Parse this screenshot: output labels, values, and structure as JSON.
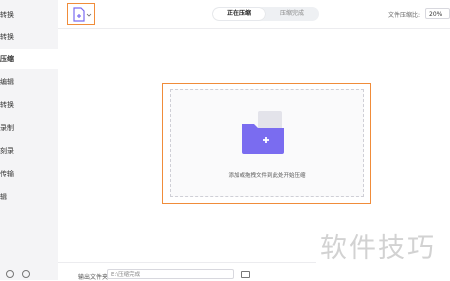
{
  "sidebar": {
    "items": [
      {
        "label": "转换"
      },
      {
        "label": "转换"
      },
      {
        "label": "压缩",
        "active": true
      },
      {
        "label": "编辑"
      },
      {
        "label": "转换"
      },
      {
        "label": "录制"
      },
      {
        "label": "刻录"
      },
      {
        "label": "传输"
      },
      {
        "label": "辑"
      }
    ],
    "bottom_icons": [
      "help-icon",
      "settings-icon"
    ]
  },
  "toolbar": {
    "add_file_icon": "add-file-icon",
    "dropdown_icon": "chevron-down-icon"
  },
  "tabs": [
    {
      "label": "正在压缩",
      "active": true
    },
    {
      "label": "压缩完成",
      "active": false
    }
  ],
  "compression": {
    "ratio_label": "文件压缩比:",
    "ratio_value": "20%"
  },
  "dropzone": {
    "icon": "folder-plus-icon",
    "text": "添加或拖拽文件到此处开始压缩"
  },
  "output": {
    "label": "输出文件夹:",
    "path": "E:\\压缩完成",
    "folder_icon": "folder-icon"
  },
  "watermark": "软件技巧",
  "colors": {
    "accent_highlight": "#f08c3a",
    "folder_purple": "#7a6cf0",
    "folder_back": "#e3e3ea"
  }
}
